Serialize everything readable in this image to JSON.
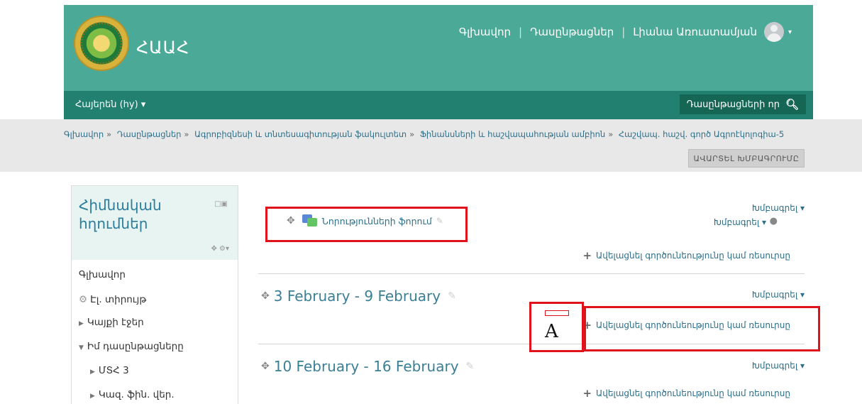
{
  "header": {
    "site_name": "ՀԱԱՀ",
    "nav": [
      "Գլխավոր",
      "Դասընթացներ",
      "Լիանա Առուստամյան"
    ],
    "user_caret": "▾"
  },
  "subnav": {
    "language": "Հայերեն (hy) ▾",
    "courses_search": "Դասընթացների որ"
  },
  "breadcrumb": [
    "Գլխավոր",
    "Դասընթացներ",
    "Ագրոբիզնեսի և տնտեսագիտության ֆակուլտետ",
    "Ֆինանսների և հաշվապահության ամբիոն",
    "Հաշվապ. հաշվ. գործ Ագրոէկոլոգիա-5"
  ],
  "breadcrumb_sep": "»",
  "edit_off_button": "ԱՎԱՐՏԵԼ ԽՄԲԱԳՐՈՒՄԸ",
  "left_block": {
    "title": "Հիմնական հղումներ",
    "items": [
      "Գլխավոր",
      "Էլ. տիրույթ",
      "Կայքի էջեր",
      "Իմ դասընթացները",
      "ՄՏՀ 3",
      "Կազ. ֆին. վեր."
    ]
  },
  "main": {
    "edit_label": "Խմբագրել ▾",
    "edit_label_user": "Խմբագրել ▾",
    "forum_name": "Նորությունների ֆորում",
    "add_activity": "Ավելացնել գործունեությունը կամ ռեսուրսը",
    "sections": [
      {
        "title": "3 February - 9 February"
      },
      {
        "title": "10 February - 16 February"
      }
    ]
  },
  "annotation": {
    "label": "A"
  },
  "colors": {
    "header_bg": "#4aaa97",
    "subnav_bg": "#21806f",
    "link": "#2c6f89",
    "annotation_red": "#e0121b"
  }
}
